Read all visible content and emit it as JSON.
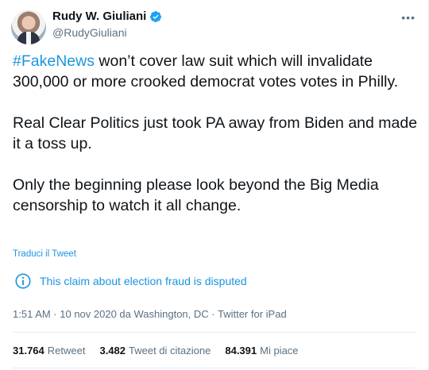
{
  "author": {
    "name": "Rudy W. Giuliani",
    "handle": "@RudyGiuliani"
  },
  "more_glyph": "•••",
  "tweet": {
    "hashtag": "#FakeNews",
    "line1_rest": " won’t cover law suit which will invalidate 300,000 or more crooked democrat votes votes in Philly.",
    "para2": "Real Clear Politics just took PA away from Biden and made it a toss up.",
    "para3": "Only the beginning please look beyond the Big Media censorship to watch it all change."
  },
  "translate_label": "Traduci il Tweet",
  "notice": {
    "text": "This claim about election fraud is disputed",
    "icon": "info-icon"
  },
  "meta": {
    "timestamp_line": "1:51 AM · 10 nov 2020 da Washington, DC · Twitter for iPad"
  },
  "stats": [
    {
      "num": "31.764",
      "label": "Retweet"
    },
    {
      "num": "3.482",
      "label": "Tweet di citazione"
    },
    {
      "num": "84.391",
      "label": "Mi piace"
    }
  ],
  "colors": {
    "accent": "#1b95e0",
    "secondary_text": "#5b7083",
    "verified": "#1da1f2"
  }
}
